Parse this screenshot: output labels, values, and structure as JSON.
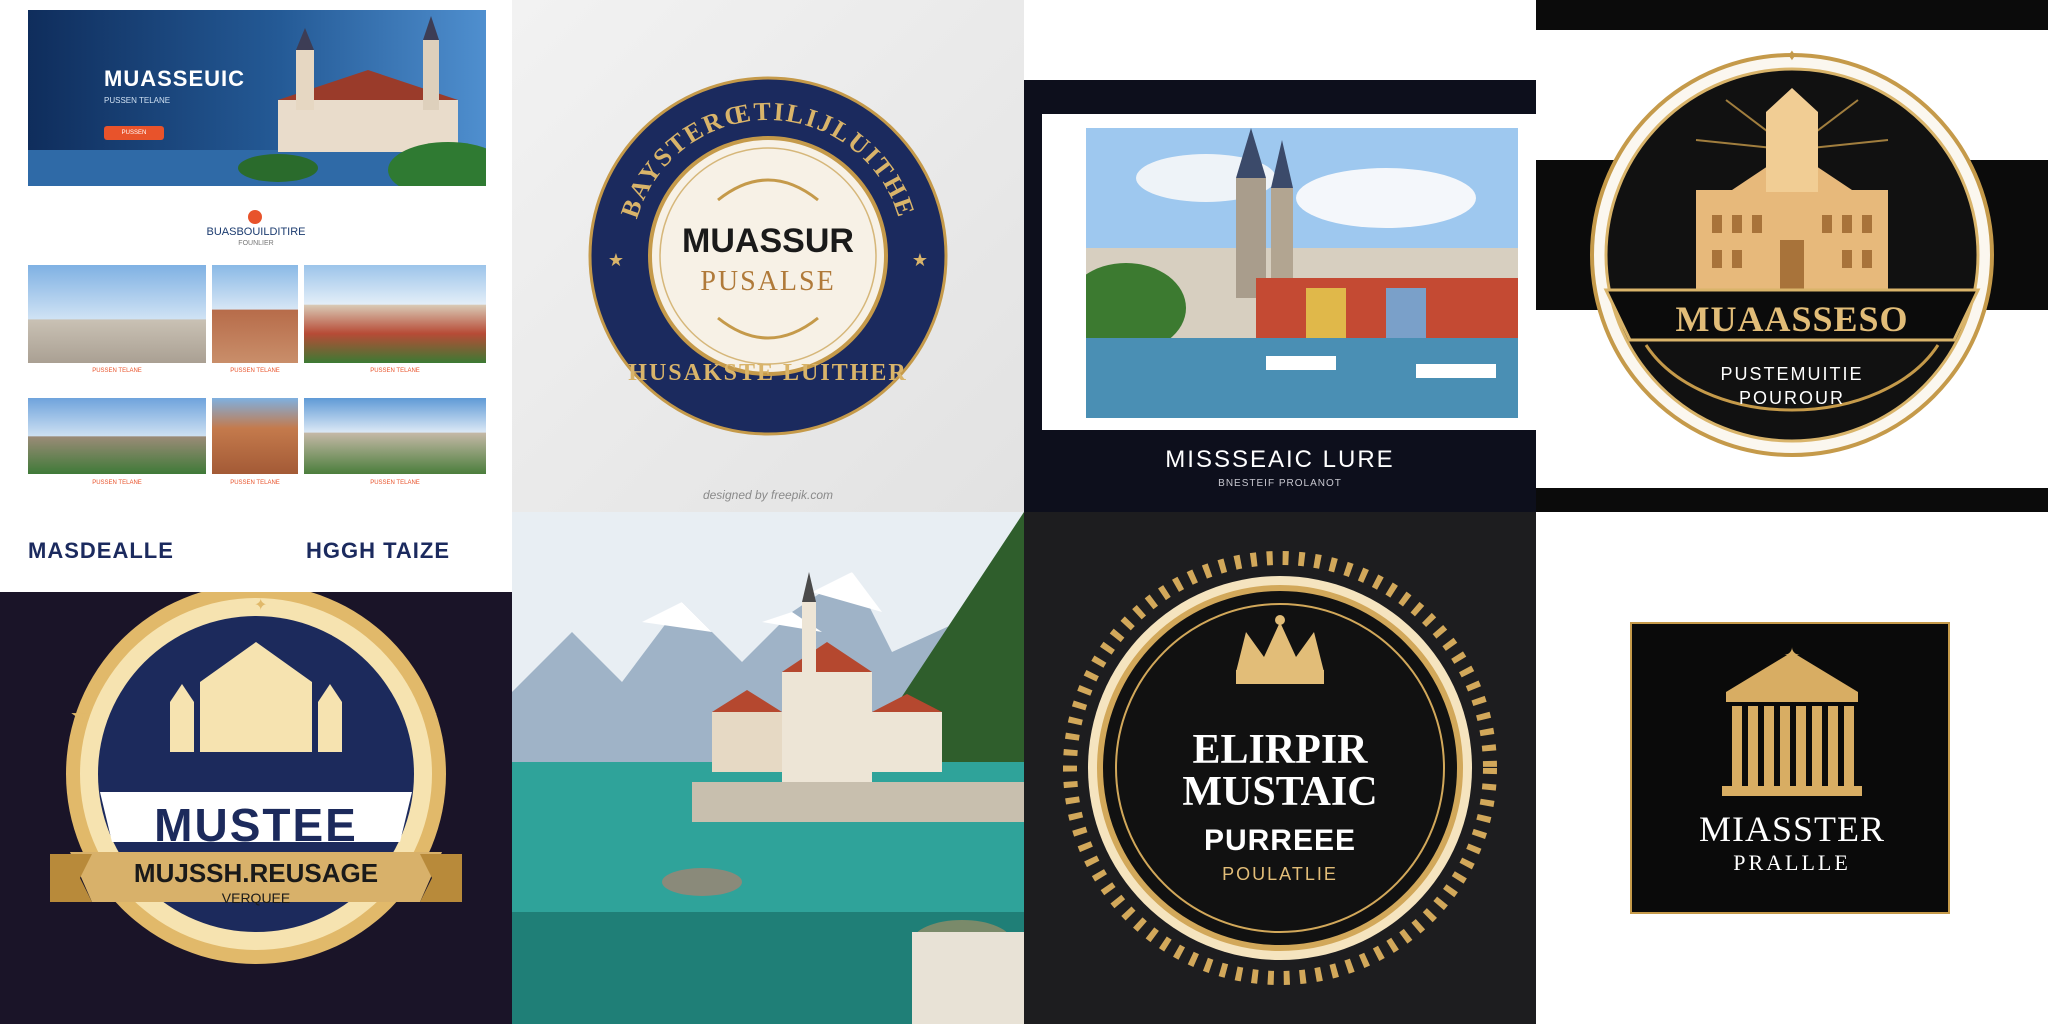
{
  "tile1": {
    "hero_title": "MUASSEUIC",
    "hero_subtitle": "PUSSEN TELANE",
    "hero_button": "PUSSEN",
    "section_title": "BUASBOUILDITIRE",
    "section_sub": "FOUNLIER",
    "captions": [
      "PUSSEN TELANE",
      "PUSSEN TELANE",
      "PUSSEN TELANE",
      "PUSSEN TELANE",
      "PUSSEN TELANE",
      "PUSSEN TELANE"
    ],
    "bottom_left": "MASDEALLE",
    "bottom_right": "HGGH TAIZE",
    "accent": "#e8532b"
  },
  "tile2": {
    "ring_top": "BAYSTERŒTILIJLUITHE",
    "ring_bottom": "HUSAKSTE LUITHER",
    "title": "MUASSUR",
    "subtitle": "PUSALSE",
    "watermark": "designed by freepik.com",
    "navy": "#1b2a5e",
    "gold": "#b88a3a"
  },
  "tile3": {
    "caption": "MISSSEAIC LURE",
    "subcaption": "BNESTEIF PROLANOT"
  },
  "tile4": {
    "title": "MUAASSESO",
    "line1": "PUSTEMUITIE",
    "line2": "POUROUR"
  },
  "tile5": {
    "title": "MUSTEE",
    "ribbon": "MUJSSH.REUSAGE",
    "small": "VERQUEE"
  },
  "tile7": {
    "line1": "ELIRPIR",
    "line2": "MUSTAIC",
    "line3": "PURREEE",
    "line4": "POULATLIE"
  },
  "tile8": {
    "line1": "MIASSTER",
    "line2": "PRALLLE"
  }
}
